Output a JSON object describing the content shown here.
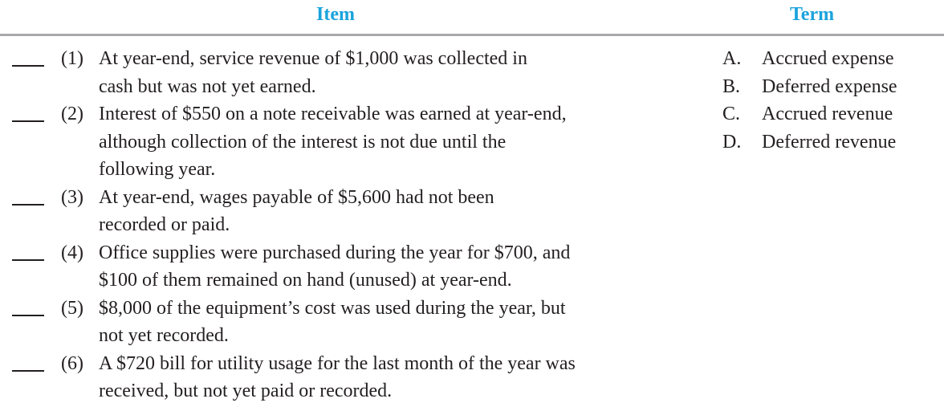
{
  "header": {
    "item_label": "Item",
    "term_label": "Term",
    "accent_color": "#1aa3dc"
  },
  "items": [
    {
      "number": "(1)",
      "lines": [
        "At year-end, service revenue of $1,000 was collected in",
        "cash but was not yet earned."
      ]
    },
    {
      "number": "(2)",
      "lines": [
        "Interest of $550 on a note receivable was earned at year-end,",
        "although collection of the interest is not due until the",
        "following year."
      ]
    },
    {
      "number": "(3)",
      "lines": [
        "At year-end, wages payable of $5,600 had not been",
        "recorded or paid."
      ]
    },
    {
      "number": "(4)",
      "lines": [
        "Office supplies were purchased during the year for $700, and",
        "$100 of them remained on hand (unused) at year-end."
      ]
    },
    {
      "number": "(5)",
      "lines": [
        "$8,000 of the equipment’s cost was used during the year, but",
        "not yet recorded."
      ]
    },
    {
      "number": "(6)",
      "lines": [
        "A $720 bill for utility usage for the last month of the year was",
        "received, but not yet paid or recorded."
      ]
    }
  ],
  "terms": [
    {
      "letter": "A.",
      "label": "Accrued expense"
    },
    {
      "letter": "B.",
      "label": "Deferred expense"
    },
    {
      "letter": "C.",
      "label": "Accrued revenue"
    },
    {
      "letter": "D.",
      "label": "Deferred revenue"
    }
  ]
}
